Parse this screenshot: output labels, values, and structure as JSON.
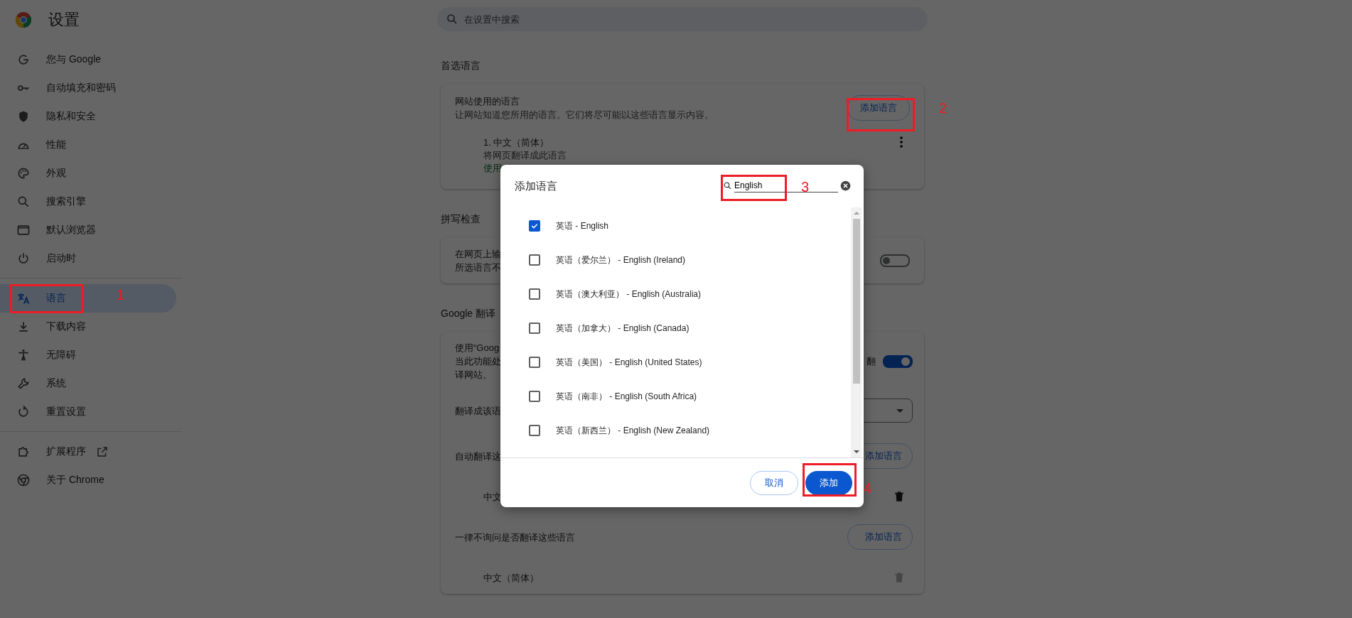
{
  "sidebar": {
    "title": "设置",
    "groups": [
      {
        "items": [
          {
            "label": "您与 Google",
            "selected": false
          },
          {
            "label": "自动填充和密码",
            "selected": false
          },
          {
            "label": "隐私和安全",
            "selected": false
          },
          {
            "label": "性能",
            "selected": false
          },
          {
            "label": "外观",
            "selected": false
          },
          {
            "label": "搜索引擎",
            "selected": false
          },
          {
            "label": "默认浏览器",
            "selected": false
          },
          {
            "label": "启动时",
            "selected": false
          }
        ]
      },
      {
        "items": [
          {
            "label": "语言",
            "selected": true
          },
          {
            "label": "下载内容",
            "selected": false
          },
          {
            "label": "无障碍",
            "selected": false
          },
          {
            "label": "系统",
            "selected": false
          },
          {
            "label": "重置设置",
            "selected": false
          }
        ]
      },
      {
        "items": [
          {
            "label": "扩展程序",
            "selected": false,
            "external_link": true
          },
          {
            "label": "关于 Chrome",
            "selected": false
          }
        ]
      }
    ]
  },
  "search": {
    "placeholder": "在设置中搜索"
  },
  "preferred_languages": {
    "heading": "首选语言",
    "title": "网站使用的语言",
    "description": "让网站知道您所用的语言。它们将尽可能以这些语言显示内容。",
    "add_button": "添加语言",
    "languages": [
      {
        "name": "1. 中文（简体）",
        "note": "将网页翻译成此语言",
        "status": "使用"
      }
    ]
  },
  "spell_check": {
    "heading": "拼写检查",
    "lines": [
      "在网页上输",
      "所选语言不"
    ],
    "on": false
  },
  "google_translate": {
    "heading": "Google 翻译",
    "lines": [
      "使用“Goog",
      "当此功能处",
      "译网站。"
    ],
    "trailing_text": "翻",
    "on": true,
    "target_label": "翻译成该语",
    "auto_translate": {
      "label": "自动翻译这",
      "add_button": "添加语言",
      "languages": [
        {
          "name": "中文",
          "disabled": false
        }
      ]
    },
    "never_translate": {
      "label": "一律不询问是否翻译这些语言",
      "add_button": "添加语言",
      "languages": [
        {
          "name": "中文（简体）",
          "disabled": true
        }
      ]
    }
  },
  "dialog": {
    "title": "添加语言",
    "search": {
      "value": "English"
    },
    "options": [
      {
        "label": "英语 - English",
        "checked": true
      },
      {
        "label": "英语（爱尔兰） - English (Ireland)",
        "checked": false
      },
      {
        "label": "英语（澳大利亚） - English (Australia)",
        "checked": false
      },
      {
        "label": "英语（加拿大） - English (Canada)",
        "checked": false
      },
      {
        "label": "英语（美国） - English (United States)",
        "checked": false
      },
      {
        "label": "英语（南非） - English (South Africa)",
        "checked": false
      },
      {
        "label": "英语（新西兰） - English (New Zealand)",
        "checked": false
      }
    ],
    "cancel_button": "取消",
    "confirm_button": "添加"
  },
  "annotations": [
    {
      "number": "1"
    },
    {
      "number": "2"
    },
    {
      "number": "3"
    },
    {
      "number": "4"
    }
  ]
}
